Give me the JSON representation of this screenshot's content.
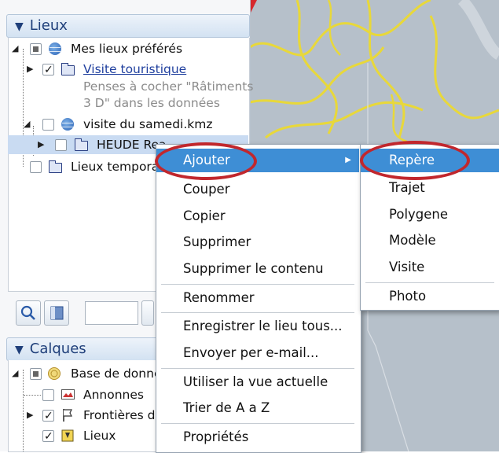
{
  "panels": {
    "places": {
      "title": "Lieux",
      "items": [
        {
          "label": "Mes lieux préférés",
          "checkbox": "partial",
          "icon": "globe-icon",
          "expander": "expanded"
        },
        {
          "label": "Visite touristique",
          "checkbox": "checked",
          "icon": "folder-icon",
          "expander": "collapsed",
          "style": "link"
        },
        {
          "description": [
            "Penses à cocher \"Râtiments",
            "3 D\" dans les données"
          ]
        },
        {
          "label": "visite du samedi.kmz",
          "checkbox": "unchecked",
          "icon": "globe-icon",
          "expander": "expanded"
        },
        {
          "label": "HEUDE Rea...",
          "checkbox": "unchecked",
          "icon": "folder-icon",
          "expander": "collapsed",
          "selected": true
        },
        {
          "label": "Lieux tempora...",
          "checkbox": "unchecked",
          "icon": "folder-icon"
        }
      ]
    },
    "layers": {
      "title": "Calques",
      "items": [
        {
          "label": "Base de donne...",
          "checkbox": "partial",
          "icon": "database-icon",
          "expander": "expanded"
        },
        {
          "label": "Annonnes",
          "checkbox": "unchecked",
          "icon": "photo-icon"
        },
        {
          "label": "Frontières de...",
          "checkbox": "checked",
          "icon": "flag-icon",
          "expander": "collapsed"
        },
        {
          "label": "Lieux",
          "checkbox": "checked",
          "icon": "places-icon"
        }
      ]
    }
  },
  "toolbar": {
    "buttons": [
      "search-icon",
      "panel-icon",
      "text-field",
      "scroll-left-icon"
    ]
  },
  "context_menu": {
    "items": [
      {
        "label": "Ajouter",
        "highlighted": true,
        "has_submenu": true
      },
      {
        "label": "Couper"
      },
      {
        "label": "Copier"
      },
      {
        "label": "Supprimer"
      },
      {
        "label": "Supprimer le contenu"
      },
      {
        "separator": true
      },
      {
        "label": "Renommer"
      },
      {
        "separator": true
      },
      {
        "label": "Enregistrer le lieu tous..."
      },
      {
        "label": "Envoyer per e-mail..."
      },
      {
        "separator": true
      },
      {
        "label": "Utiliser la vue actuelle"
      },
      {
        "label": "Trier de A a Z"
      },
      {
        "separator": true
      },
      {
        "label": "Propriétés"
      }
    ]
  },
  "submenu": {
    "items": [
      {
        "label": "Repère",
        "highlighted": true
      },
      {
        "label": "Trajet"
      },
      {
        "label": "Polygene"
      },
      {
        "label": "Modèle"
      },
      {
        "label": "Visite"
      },
      {
        "separator": true
      },
      {
        "label": "Photo"
      }
    ]
  },
  "colors": {
    "highlight": "#3e8ed5",
    "annotation_ring": "#c1272d",
    "map_borders": "#e8d83a",
    "header_text": "#1f3f7a"
  }
}
